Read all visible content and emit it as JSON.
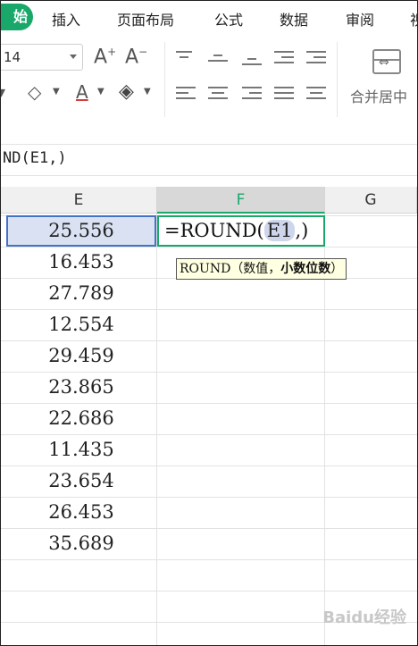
{
  "menu": {
    "start_label": "始",
    "items": [
      "插入",
      "页面布局",
      "公式",
      "数据",
      "审阅",
      "视"
    ]
  },
  "ribbon": {
    "font_size": "14",
    "merge_label": "合并居中"
  },
  "formula_bar": {
    "text": "ND(E1,)"
  },
  "columns": [
    "E",
    "F",
    "G"
  ],
  "active_column": "F",
  "cells_E": [
    "25.556",
    "16.453",
    "27.789",
    "12.554",
    "29.459",
    "23.865",
    "22.686",
    "11.435",
    "23.654",
    "26.453",
    "35.689"
  ],
  "editing_cell": {
    "prefix": "=ROUND(",
    "ref": "E1",
    "suffix": ",)"
  },
  "tooltip": {
    "func": "ROUND",
    "arg1": "（数值，",
    "arg2": "小数位数",
    "close": "）"
  },
  "watermark": "Baidu经验"
}
